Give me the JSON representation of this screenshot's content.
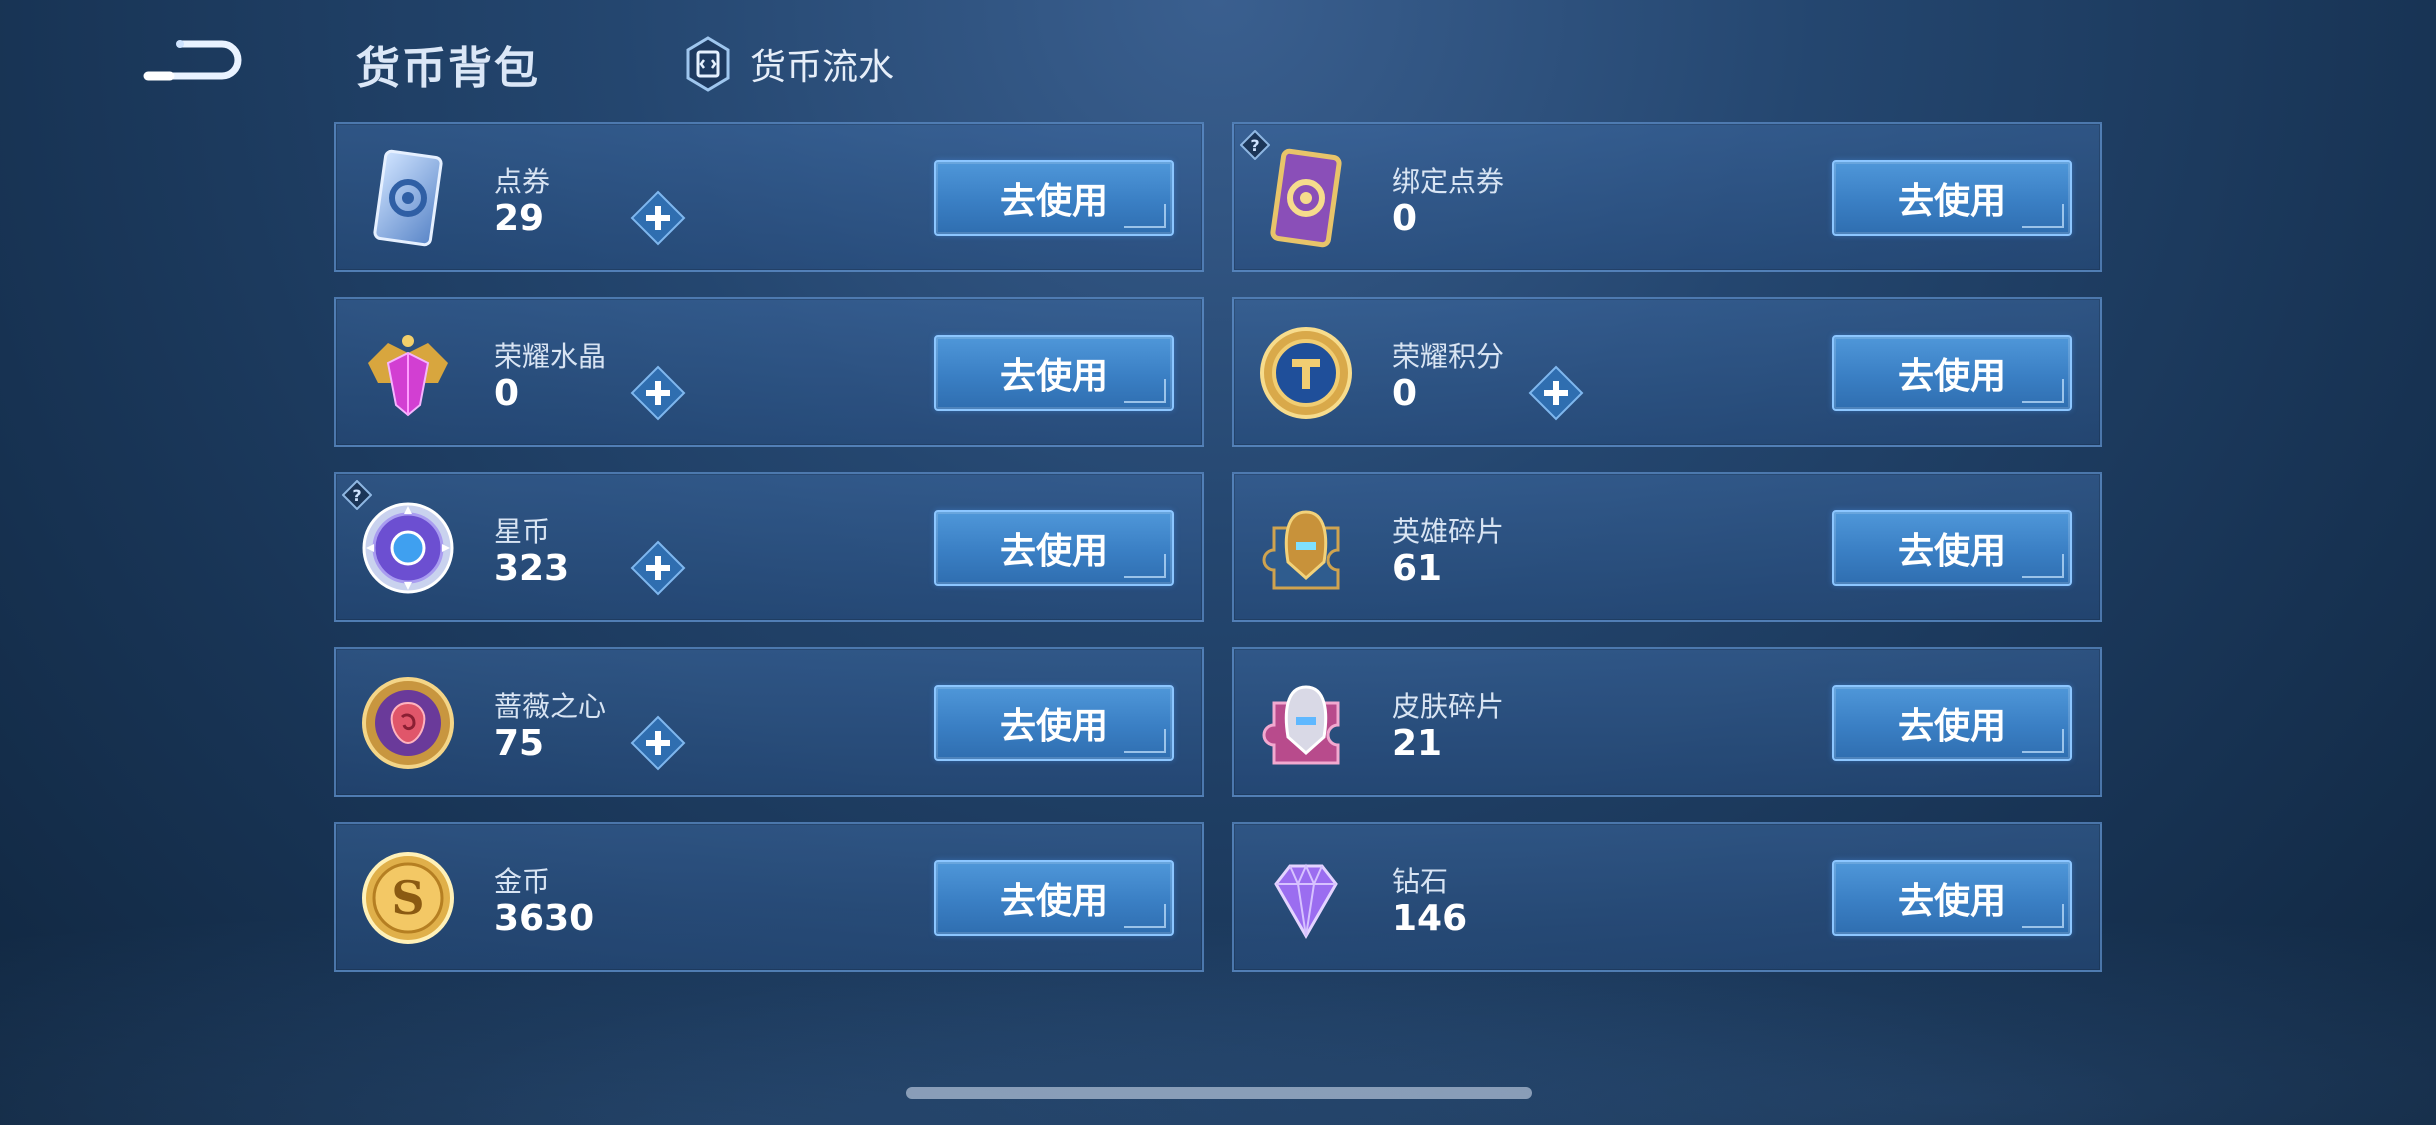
{
  "header": {
    "title": "货币背包",
    "ledger_label": "货币流水"
  },
  "colors": {
    "card_bg": "#2f5a8e",
    "button": "#3a7fc4",
    "button_border": "#8cc6ff"
  },
  "cards": [
    {
      "name": "点券",
      "count": "29",
      "button": "去使用",
      "icon": "voucher-blue-icon",
      "has_plus": true,
      "has_help": false
    },
    {
      "name": "绑定点券",
      "count": "0",
      "button": "去使用",
      "icon": "bound-voucher-purple-icon",
      "has_plus": false,
      "has_help": true
    },
    {
      "name": "荣耀水晶",
      "count": "0",
      "button": "去使用",
      "icon": "glory-crystal-icon",
      "has_plus": true,
      "has_help": false
    },
    {
      "name": "荣耀积分",
      "count": "0",
      "button": "去使用",
      "icon": "glory-points-icon",
      "has_plus": true,
      "has_help": false
    },
    {
      "name": "星币",
      "count": "323",
      "button": "去使用",
      "icon": "star-coin-icon",
      "has_plus": true,
      "has_help": true
    },
    {
      "name": "英雄碎片",
      "count": "61",
      "button": "去使用",
      "icon": "hero-fragment-icon",
      "has_plus": false,
      "has_help": false
    },
    {
      "name": "蔷薇之心",
      "count": "75",
      "button": "去使用",
      "icon": "rose-heart-icon",
      "has_plus": true,
      "has_help": false
    },
    {
      "name": "皮肤碎片",
      "count": "21",
      "button": "去使用",
      "icon": "skin-fragment-icon",
      "has_plus": false,
      "has_help": false
    },
    {
      "name": "金币",
      "count": "3630",
      "button": "去使用",
      "icon": "gold-coin-icon",
      "has_plus": false,
      "has_help": false
    },
    {
      "name": "钻石",
      "count": "146",
      "button": "去使用",
      "icon": "diamond-icon",
      "has_plus": false,
      "has_help": false
    }
  ]
}
